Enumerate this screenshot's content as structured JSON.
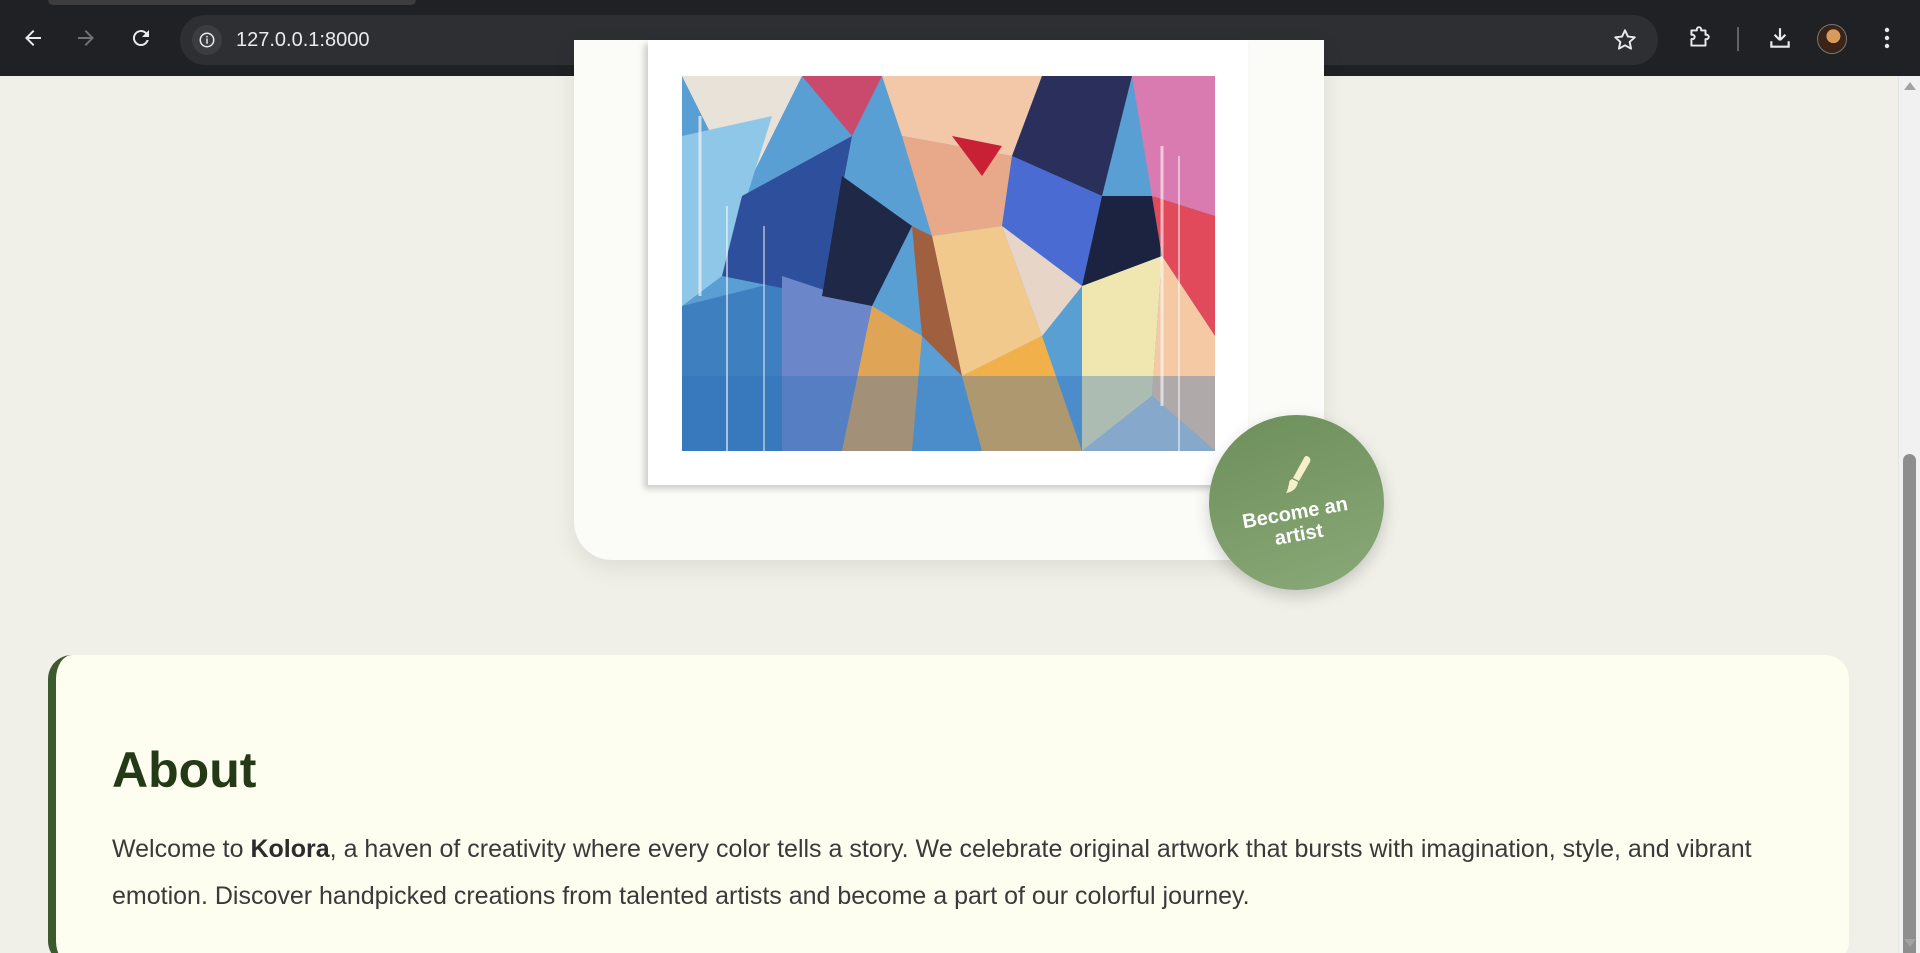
{
  "browser": {
    "url": "127.0.0.1:8000",
    "icons": {
      "back": "arrow-left-icon",
      "forward": "arrow-right-icon",
      "reload": "reload-icon",
      "site_info": "info-icon",
      "bookmark": "star-icon",
      "extensions": "puzzle-icon",
      "downloads": "download-icon",
      "menu": "kebab-menu-icon"
    }
  },
  "hero": {
    "badge": {
      "icon": "paintbrush-icon",
      "label": "Become an artist",
      "color": "#7a9a68"
    }
  },
  "about": {
    "title": "About",
    "text_before": "Welcome to ",
    "brand": "Kolora",
    "text_after": ", a haven of creativity where every color tells a story. We celebrate original artwork that bursts with imagination, style, and vibrant emotion. Discover handpicked creations from talented artists and become a part of our colorful journey.",
    "accent_color": "#3d5a2e"
  }
}
